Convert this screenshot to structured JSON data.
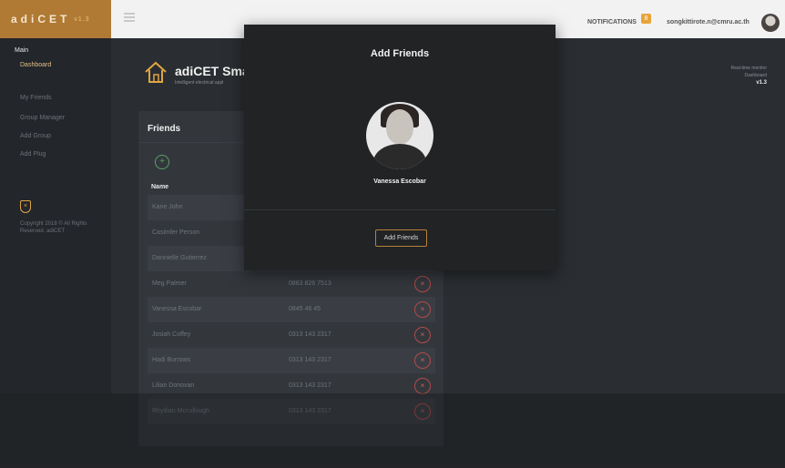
{
  "topbar": {
    "brand": "adiCET",
    "brand_version": "v1.3",
    "notifications_label": "NOTIFICATIONS",
    "notifications_count": "8",
    "user_email": "songkittirote.n@cmru.ac.th"
  },
  "sidebar": {
    "section": "Main",
    "items": [
      {
        "label": "Dashboard"
      },
      {
        "label": "My Friends"
      },
      {
        "label": "Group Manager"
      },
      {
        "label": "Add Group"
      },
      {
        "label": "Add Plug"
      }
    ],
    "copyright": "Copyright 2018 © All Rights Reserved. adiCET"
  },
  "header": {
    "title": "adiCET Sma",
    "subtitle": "Intelligent electrical appl",
    "realtime_label": "Real-time monitor",
    "realtime_page": "Dashboard",
    "version": "v1.3"
  },
  "friends_card": {
    "title": "Friends",
    "add_symbol": "+",
    "col_name": "Name",
    "delete_symbol": "×",
    "rows": [
      {
        "name": "Kane John",
        "phone": ""
      },
      {
        "name": "Casimfer Person",
        "phone": ""
      },
      {
        "name": "Dannielle Gutierrez",
        "phone": ""
      },
      {
        "name": "Meg Palmer",
        "phone": "0863 826 7513"
      },
      {
        "name": "Vanessa Escobar",
        "phone": "0845 46 45"
      },
      {
        "name": "Josiah Coffey",
        "phone": "0313 143 2317"
      },
      {
        "name": "Hadi Burrows",
        "phone": "0313 143 2317"
      },
      {
        "name": "Lilian Donovan",
        "phone": "0313 143 2317"
      },
      {
        "name": "Rhydian Mccullough",
        "phone": "0313 143 2317"
      }
    ]
  },
  "modal": {
    "title": "Add Friends",
    "friend_name": "Vanessa Escobar",
    "button_label": "Add Friends"
  }
}
